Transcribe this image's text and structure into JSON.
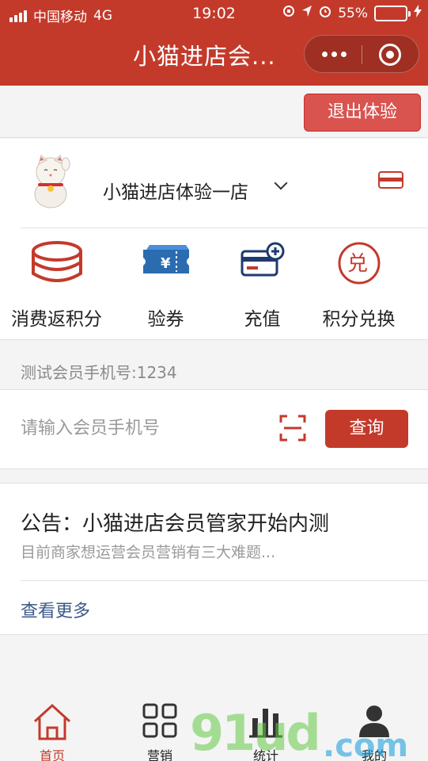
{
  "status_bar": {
    "carrier": "中国移动",
    "network": "4G",
    "time": "19:02",
    "battery": "55%",
    "battery_level": 0.55
  },
  "nav": {
    "title": "小猫进店会..."
  },
  "exit_button": "退出体验",
  "store": {
    "name": "小猫进店体验一店"
  },
  "actions": [
    {
      "label": "消费返积分",
      "icon": "coin-stack-icon"
    },
    {
      "label": "验券",
      "icon": "ticket-icon"
    },
    {
      "label": "充值",
      "icon": "card-plus-icon"
    },
    {
      "label": "积分兑换",
      "icon": "exchange-icon"
    }
  ],
  "tip": "测试会员手机号:1234",
  "search": {
    "placeholder": "请输入会员手机号",
    "button": "查询"
  },
  "notice": {
    "title": "公告：小猫进店会员管家开始内测",
    "summary": "目前商家想运营会员营销有三大难题...",
    "more": "查看更多"
  },
  "tabs": [
    {
      "label": "首页",
      "active": true
    },
    {
      "label": "营销",
      "active": false
    },
    {
      "label": "统计",
      "active": false
    },
    {
      "label": "我的",
      "active": false
    }
  ],
  "watermark": {
    "text": "91ud",
    "suffix": ".com"
  },
  "colors": {
    "primary": "#c33a2b",
    "exit_button": "#d9534f",
    "link": "#3c5a8a"
  }
}
